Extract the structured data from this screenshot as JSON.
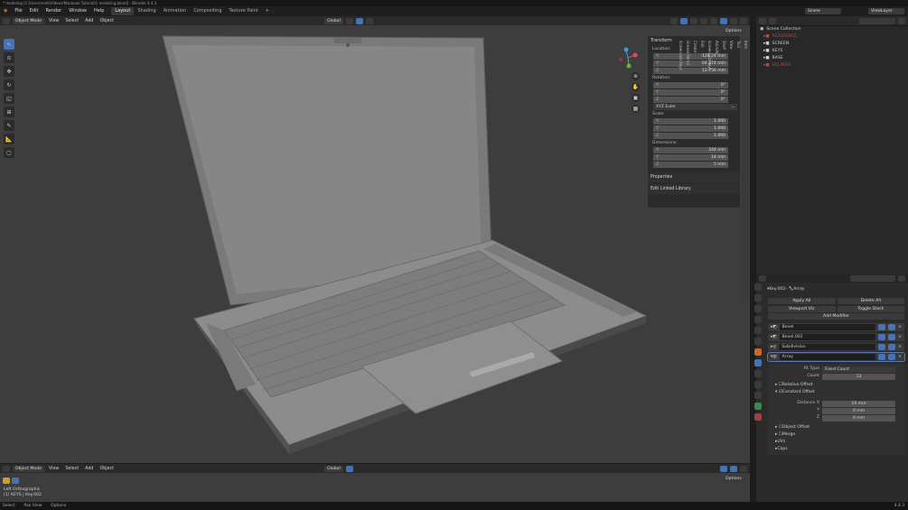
{
  "window_title": "* modeling [C:\\Users\\nafe\\Videos\\Macbook Tutorial\\1 modeling.blend] - Blender 4.4.3",
  "menu": [
    "File",
    "Edit",
    "Render",
    "Window",
    "Help"
  ],
  "workspace_tabs": [
    "Layout",
    "Shading",
    "Animation",
    "Compositing",
    "Texture Paint"
  ],
  "workspace_add": "+",
  "scene": {
    "label": "Scene",
    "view_layer": "ViewLayer"
  },
  "viewport_header": {
    "mode": "Object Mode",
    "menus": [
      "View",
      "Select",
      "Add",
      "Object"
    ],
    "orientation": "Global",
    "options": "Options"
  },
  "npanel": {
    "transform": "Transform",
    "location": {
      "label": "Location:",
      "x": "-128.24 mm",
      "y": "64.274 mm",
      "z": "12.756 mm"
    },
    "rotation": {
      "label": "Rotation:",
      "x": "0°",
      "y": "0°",
      "z": "0°",
      "mode": "XYZ Euler"
    },
    "scale": {
      "label": "Scale:",
      "x": "1.000",
      "y": "1.000",
      "z": "1.000"
    },
    "dimensions": {
      "label": "Dimensions:",
      "x": "244 mm",
      "y": "14 mm",
      "z": "5 mm"
    },
    "properties": "Properties",
    "edit_linked": "Edit Linked Library"
  },
  "side_tabs": [
    "Item",
    "Tool",
    "View",
    "Shelf",
    "AnimAll",
    "Screencast Keys",
    "Edit",
    "Create",
    "Grease Pencil",
    "Screencast Keys"
  ],
  "outliner": {
    "title": "Scene Collection",
    "items": [
      "REFERENCE",
      "SCREEN",
      "KEYS",
      "BASE",
      "HELPERS"
    ]
  },
  "properties": {
    "search_placeholder": "",
    "object": "Key.002",
    "modifier_name": "Array",
    "apply_all": "Apply All",
    "delete_all": "Delete All",
    "viewport_vis": "Viewport Vis",
    "toggle_stack": "Toggle Stack",
    "add_modifier": "Add Modifier",
    "modifiers": [
      "Bevel",
      "Bevel.001",
      "Subdivision",
      "Array"
    ],
    "fit_type_label": "Fit Type",
    "fit_type": "Fixed Count",
    "count_label": "Count",
    "count": "13",
    "relative_offset": "Relative Offset",
    "constant_offset": "Constant Offset",
    "distance_x_label": "Distance X",
    "distance_x": "19 mm",
    "y_label": "Y",
    "y": "0 mm",
    "z_label": "Z",
    "z": "0 mm",
    "object_offset": "Object Offset",
    "merge": "Merge",
    "uvs": "UVs",
    "caps": "Caps"
  },
  "bottom_view": {
    "title": "Left Orthographic",
    "sub": "(1) KEYS | Key.002",
    "mode": "Object Mode",
    "menus": [
      "View",
      "Select",
      "Add",
      "Object"
    ],
    "orientation": "Global",
    "options": "Options"
  },
  "status": [
    "Select",
    "Pan View",
    "Options"
  ],
  "version": "4.4.3",
  "colors": {
    "accent": "#4772b3",
    "bg": "#1d1d1d",
    "viewport": "#3d3d3d"
  }
}
